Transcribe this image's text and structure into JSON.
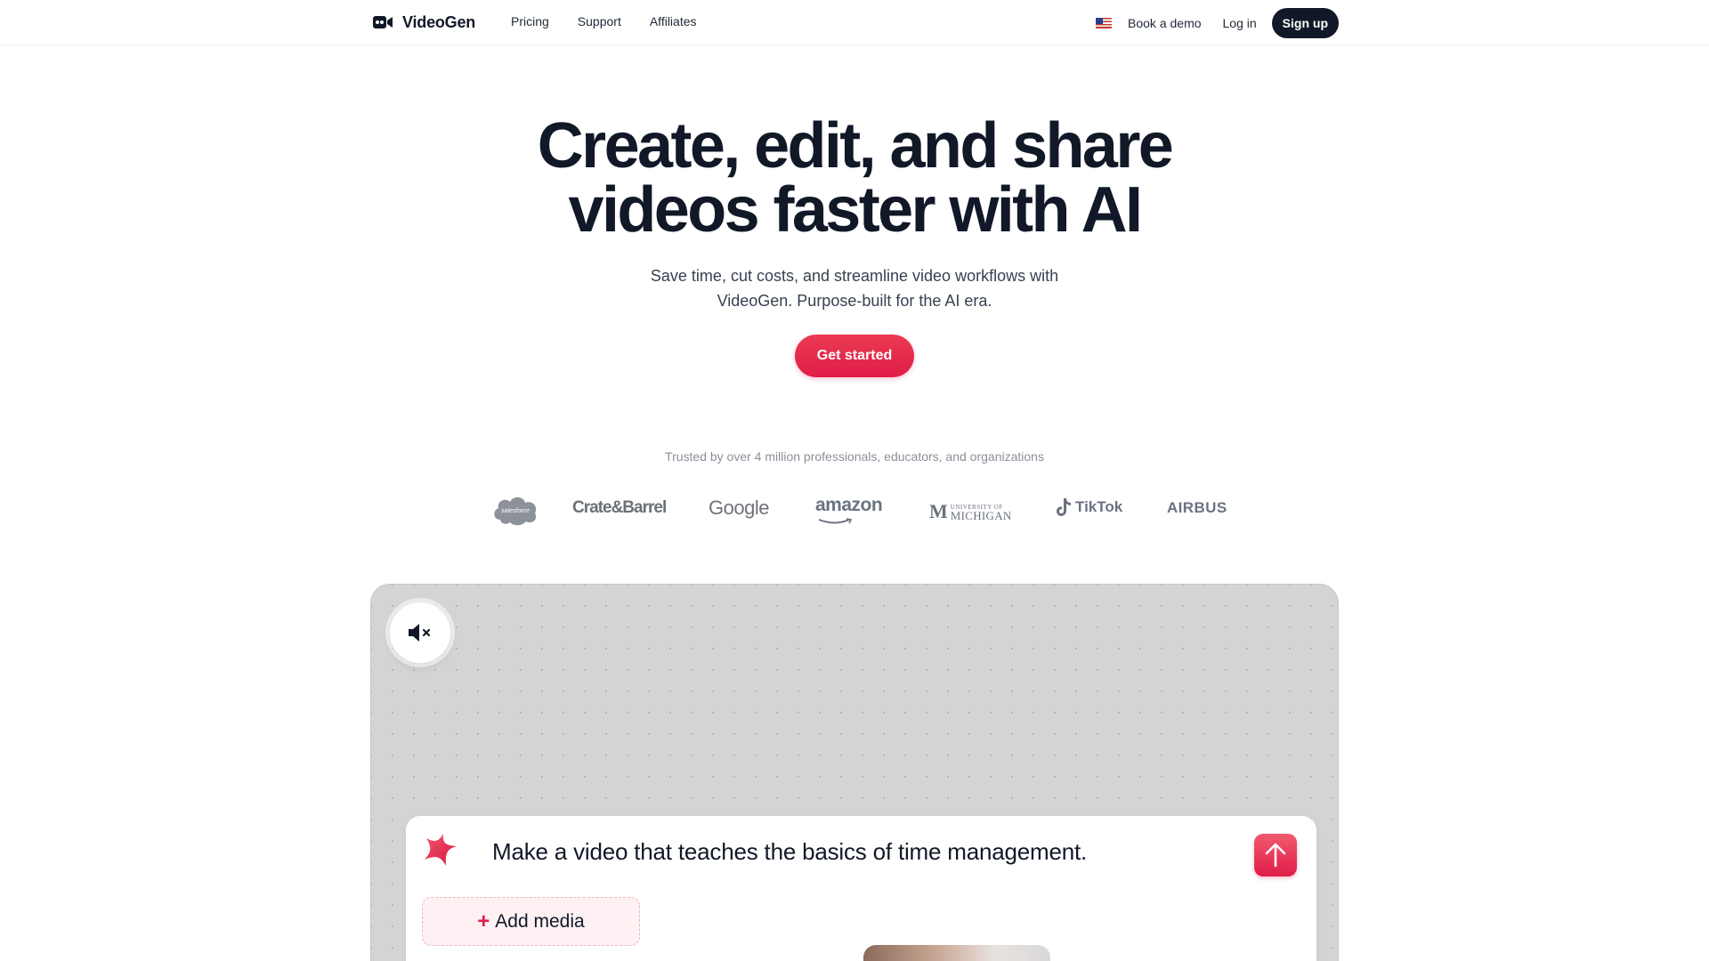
{
  "nav": {
    "brand": "VideoGen",
    "links": [
      "Pricing",
      "Support",
      "Affiliates"
    ],
    "book_demo": "Book a demo",
    "login": "Log in",
    "signup": "Sign up"
  },
  "hero": {
    "title_line1": "Create, edit, and share",
    "title_line2": "videos faster with AI",
    "subtitle_line1": "Save time, cut costs, and streamline video workflows with",
    "subtitle_line2": "VideoGen. Purpose-built for the AI era.",
    "cta": "Get started"
  },
  "trusted": {
    "text": "Trusted by over 4 million professionals, educators, and organizations",
    "logos": {
      "salesforce": "salesforce",
      "cratebarrel": "Crate&Barrel",
      "google": "Google",
      "amazon": "amazon",
      "um_m": "M",
      "um_line1": "UNIVERSITY OF",
      "um_line2": "MICHIGAN",
      "tiktok": "TikTok",
      "airbus": "AIRBUS"
    }
  },
  "demo": {
    "prompt_text": "Make a video that teaches the basics of time management.",
    "add_media_plus": "+",
    "add_media_label": "Add media"
  },
  "colors": {
    "accent": "#e11d48",
    "dark": "#111827",
    "panel_bg": "#d4d4d4"
  },
  "icons": {
    "brand": "video-camera-icon",
    "mute": "speaker-muted-icon",
    "spark": "sparkle-star-icon",
    "send": "arrow-up-icon",
    "flag": "us-flag-icon"
  }
}
